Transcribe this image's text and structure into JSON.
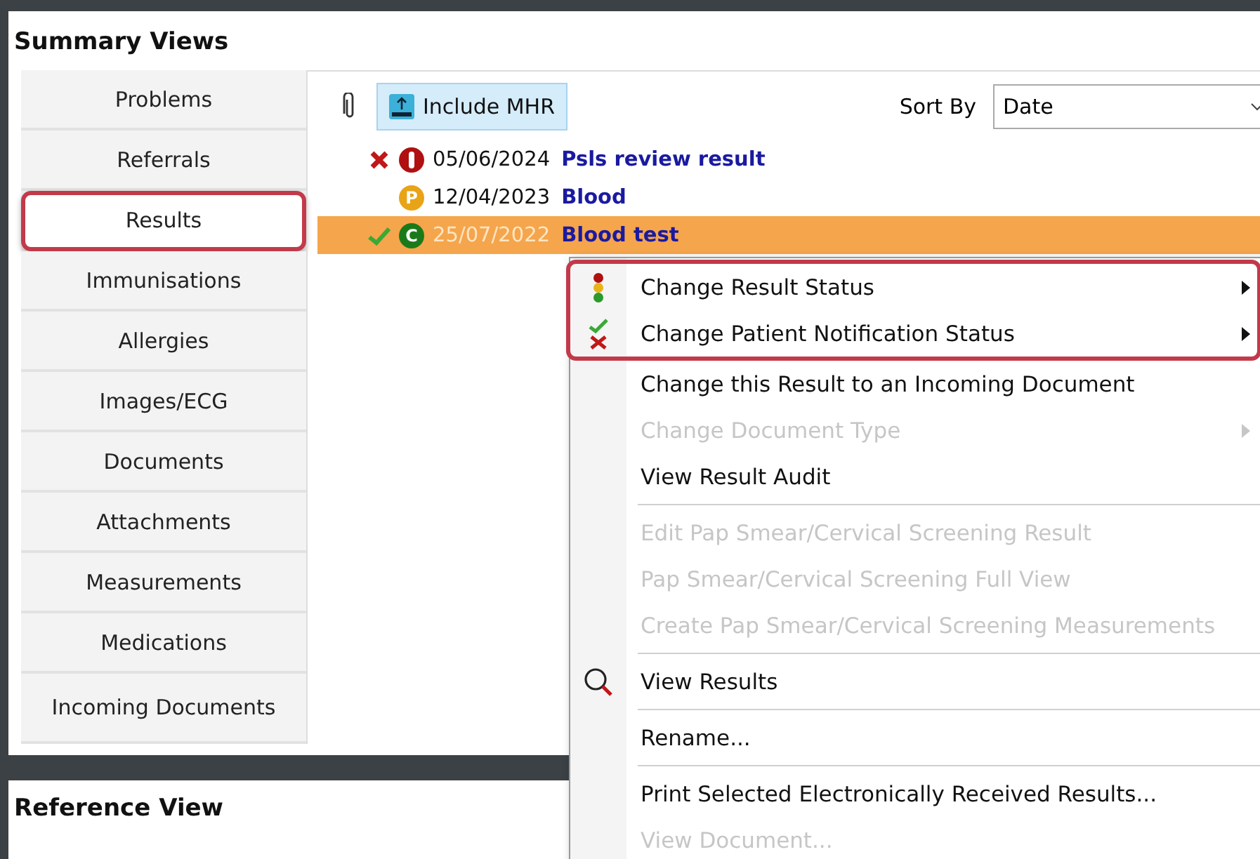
{
  "summary": {
    "title": "Summary Views"
  },
  "tabs": [
    {
      "label": "Problems",
      "selected": false,
      "highlighted": false
    },
    {
      "label": "Referrals",
      "selected": false,
      "highlighted": false
    },
    {
      "label": "Results",
      "selected": true,
      "highlighted": true
    },
    {
      "label": "Immunisations",
      "selected": false,
      "highlighted": false
    },
    {
      "label": "Allergies",
      "selected": false,
      "highlighted": false
    },
    {
      "label": "Images/ECG",
      "selected": false,
      "highlighted": false
    },
    {
      "label": "Documents",
      "selected": false,
      "highlighted": false
    },
    {
      "label": "Attachments",
      "selected": false,
      "highlighted": false
    },
    {
      "label": "Measurements",
      "selected": false,
      "highlighted": false
    },
    {
      "label": "Medications",
      "selected": false,
      "highlighted": false
    },
    {
      "label": "Incoming Documents",
      "selected": false,
      "highlighted": false
    }
  ],
  "toolbar": {
    "include_button": "Include MHR",
    "sort_label": "Sort By",
    "sort_value": "Date"
  },
  "results": [
    {
      "kind": "not-notified",
      "badge": {
        "kind": "alert",
        "color": "#b01010"
      },
      "date": "05/06/2024",
      "title": "Psls review result",
      "selected": false
    },
    {
      "kind": "unmarked",
      "badge": {
        "kind": "letter",
        "text": "P",
        "color": "#e8a317"
      },
      "date": "12/04/2023",
      "title": "Blood",
      "selected": false
    },
    {
      "kind": "notified",
      "badge": {
        "kind": "letter",
        "text": "C",
        "color": "#1a7a1a"
      },
      "date": "25/07/2022",
      "title": "Blood test",
      "selected": true
    }
  ],
  "context_menu": [
    {
      "kind": "status",
      "label": "Change Result Status",
      "submenu": true,
      "disabled": false,
      "highlighted": true,
      "divider_after": false
    },
    {
      "kind": "notification",
      "label": "Change Patient Notification Status",
      "submenu": true,
      "disabled": false,
      "highlighted": true,
      "divider_after": false
    },
    {
      "kind": "plain",
      "label": "Change this Result to an Incoming Document",
      "submenu": false,
      "disabled": false,
      "highlighted": false,
      "divider_after": false
    },
    {
      "kind": "plain",
      "label": "Change Document Type",
      "submenu": true,
      "disabled": true,
      "highlighted": false,
      "divider_after": false
    },
    {
      "kind": "plain",
      "label": "View Result Audit",
      "submenu": false,
      "disabled": false,
      "highlighted": false,
      "divider_after": true
    },
    {
      "kind": "plain",
      "label": "Edit Pap Smear/Cervical Screening Result",
      "submenu": false,
      "disabled": true,
      "highlighted": false,
      "divider_after": false
    },
    {
      "kind": "plain",
      "label": "Pap Smear/Cervical Screening Full View",
      "submenu": false,
      "disabled": true,
      "highlighted": false,
      "divider_after": false
    },
    {
      "kind": "plain",
      "label": "Create Pap Smear/Cervical Screening Measurements",
      "submenu": false,
      "disabled": true,
      "highlighted": false,
      "divider_after": true
    },
    {
      "kind": "search",
      "label": "View Results",
      "submenu": false,
      "disabled": false,
      "highlighted": false,
      "divider_after": true
    },
    {
      "kind": "plain",
      "label": "Rename...",
      "submenu": false,
      "disabled": false,
      "highlighted": false,
      "divider_after": true
    },
    {
      "kind": "plain",
      "label": "Print Selected Electronically Received Results...",
      "submenu": false,
      "disabled": false,
      "highlighted": false,
      "divider_after": false
    },
    {
      "kind": "plain",
      "label": "View Document...",
      "submenu": false,
      "disabled": true,
      "highlighted": false,
      "divider_after": false
    }
  ],
  "reference": {
    "title": "Reference View"
  }
}
